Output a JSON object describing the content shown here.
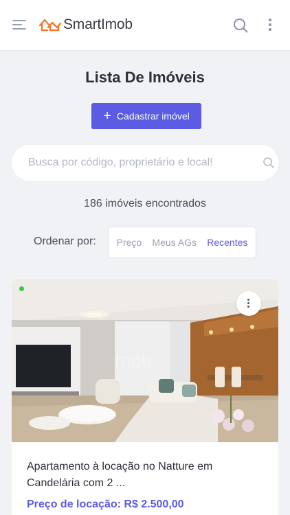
{
  "header": {
    "brand": "SmartImob",
    "menu_icon": "hamburger-menu-icon",
    "search_icon": "search-icon",
    "more_icon": "kebab-menu-icon",
    "brand_color": "#f47a2a"
  },
  "page": {
    "title": "Lista De Imóveis",
    "cta_label": "Cadastrar imóvel",
    "cta_icon": "plus-icon",
    "accent": "#5b5be3"
  },
  "search": {
    "placeholder": "Busca por código, proprietário e local!",
    "value": ""
  },
  "results": {
    "count_text": "186 imóveis encontrados"
  },
  "sort": {
    "label": "Ordenar por:",
    "options": [
      "Preço",
      "Meus AGs",
      "Recentes"
    ],
    "selected": "Recentes"
  },
  "listing": {
    "status": "active",
    "status_color": "#2ecc40",
    "title": "Apartamento à locação no Natture em Candelária com 2 ...",
    "price": "Preço de locação: R$ 2.500,00",
    "image": "living-room-photo"
  }
}
